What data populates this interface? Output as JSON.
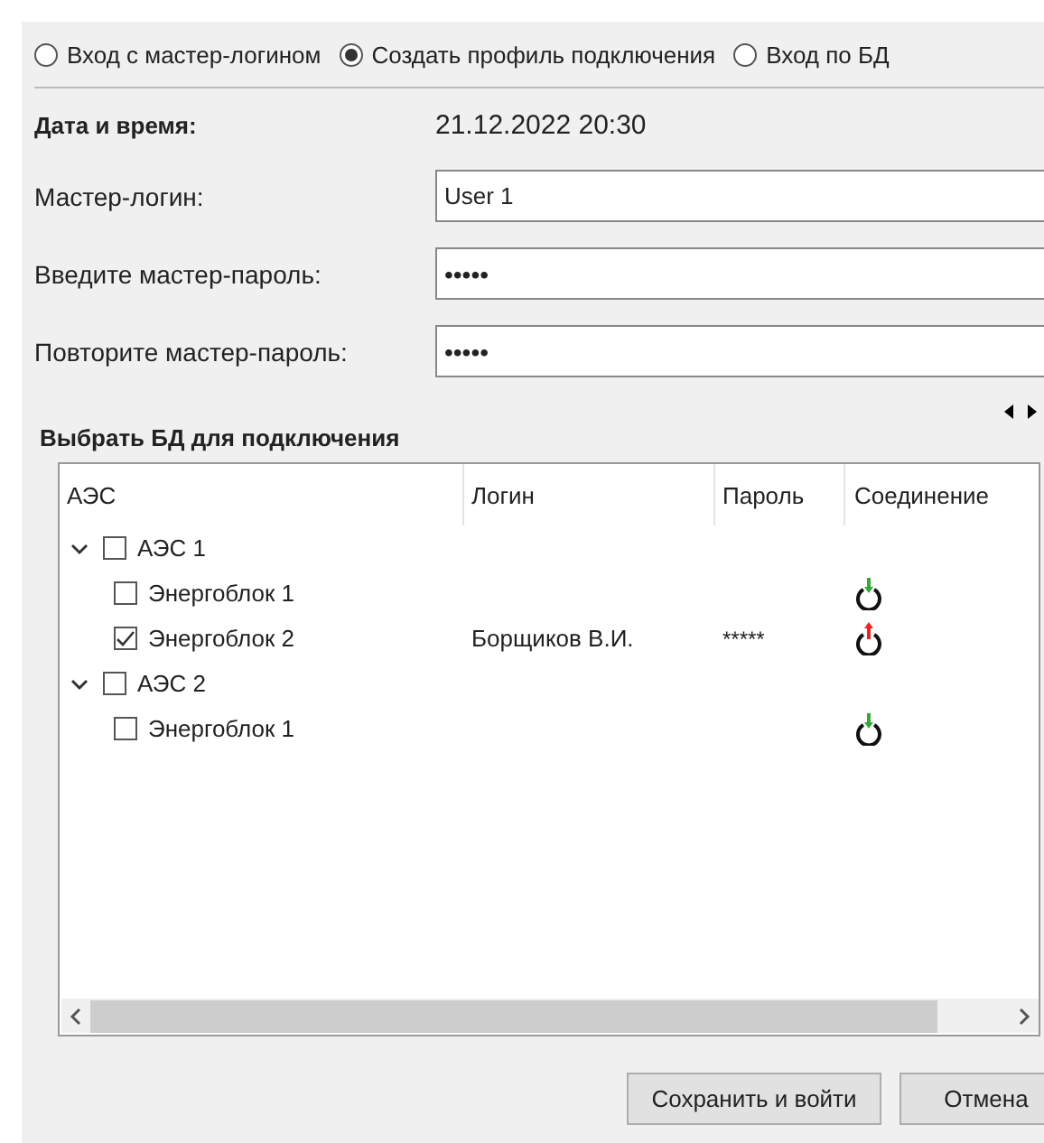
{
  "modes": [
    {
      "label": "Вход с мастер-логином",
      "selected": false
    },
    {
      "label": "Создать профиль подключения",
      "selected": true
    },
    {
      "label": "Вход по БД",
      "selected": false
    }
  ],
  "datetime": {
    "label": "Дата и время:",
    "value": "21.12.2022 20:30"
  },
  "fields": [
    {
      "label": "Мастер-логин:",
      "value": "User 1",
      "kind": "text"
    },
    {
      "label": "Введите мастер-пароль:",
      "value": "•••••",
      "kind": "password"
    },
    {
      "label": "Повторите мастер-пароль:",
      "value": "•••••",
      "kind": "password"
    }
  ],
  "db_section": {
    "title": "Выбрать БД для подключения",
    "columns": [
      "АЭС",
      "Логин",
      "Пароль",
      "Соединение"
    ],
    "tree": [
      {
        "name": "АЭС 1",
        "expanded": true,
        "checked": false,
        "children": [
          {
            "name": "Энергоблок 1",
            "checked": false,
            "connected": true
          },
          {
            "name": "Энергоблок 2",
            "checked": true,
            "login": "Борщиков В.И.",
            "password": "*****",
            "connected": false
          }
        ]
      },
      {
        "name": "АЭС 2",
        "expanded": true,
        "checked": false,
        "children": [
          {
            "name": "Энергоблок 1",
            "checked": false,
            "connected": true
          }
        ]
      }
    ]
  },
  "buttons": [
    "Сохранить и войти",
    "Отмена"
  ]
}
